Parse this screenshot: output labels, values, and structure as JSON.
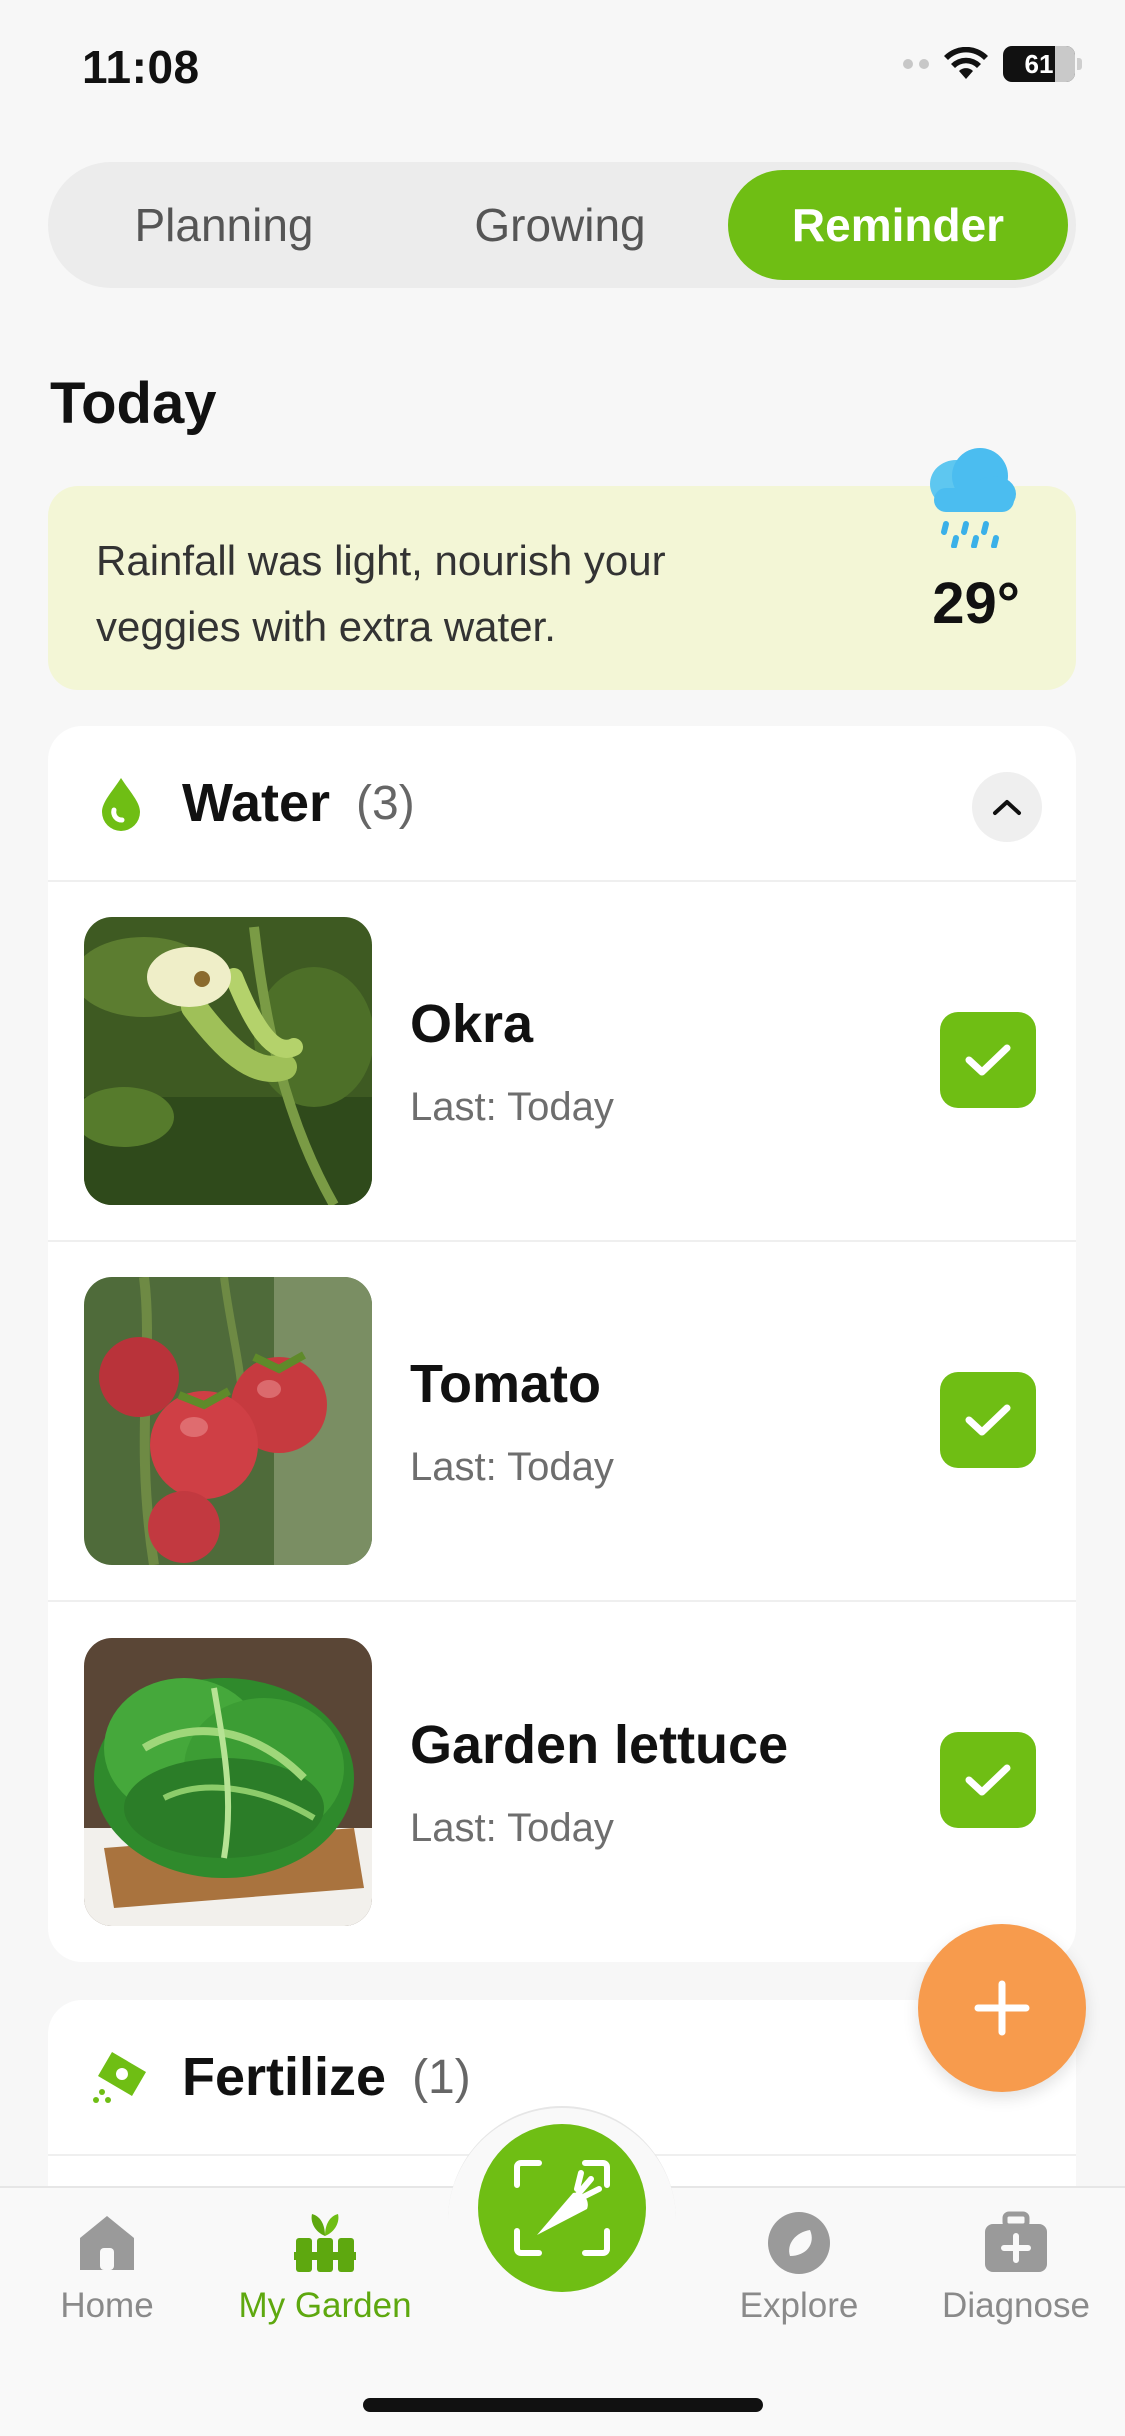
{
  "status_bar": {
    "time": "11:08",
    "battery": "61"
  },
  "segmented": {
    "tabs": [
      "Planning",
      "Growing",
      "Reminder"
    ],
    "active": "Reminder"
  },
  "section_title": "Today",
  "weather": {
    "message": "Rainfall was light, nourish your veggies with extra water.",
    "temperature": "29°",
    "icon": "rain-cloud-icon"
  },
  "water_card": {
    "title": "Water",
    "count": "(3)",
    "icon": "water-drop-icon",
    "items": [
      {
        "name": "Okra",
        "last": "Last: Today",
        "checked": true
      },
      {
        "name": "Tomato",
        "last": "Last: Today",
        "checked": true
      },
      {
        "name": "Garden lettuce",
        "last": "Last: Today",
        "checked": true
      }
    ]
  },
  "fertilize_card": {
    "title": "Fertilize",
    "count": "(1)",
    "icon": "fertilizer-bag-icon"
  },
  "tab_bar": {
    "items": [
      {
        "label": "Home",
        "icon": "home-icon"
      },
      {
        "label": "My Garden",
        "icon": "garden-icon"
      },
      {
        "label": "Explore",
        "icon": "compass-icon"
      },
      {
        "label": "Diagnose",
        "icon": "first-aid-kit-icon"
      }
    ],
    "active": "My Garden"
  },
  "colors": {
    "accent": "#6fbe14",
    "fab": "#f79b4d",
    "weather_bg": "#f3f6d6"
  }
}
